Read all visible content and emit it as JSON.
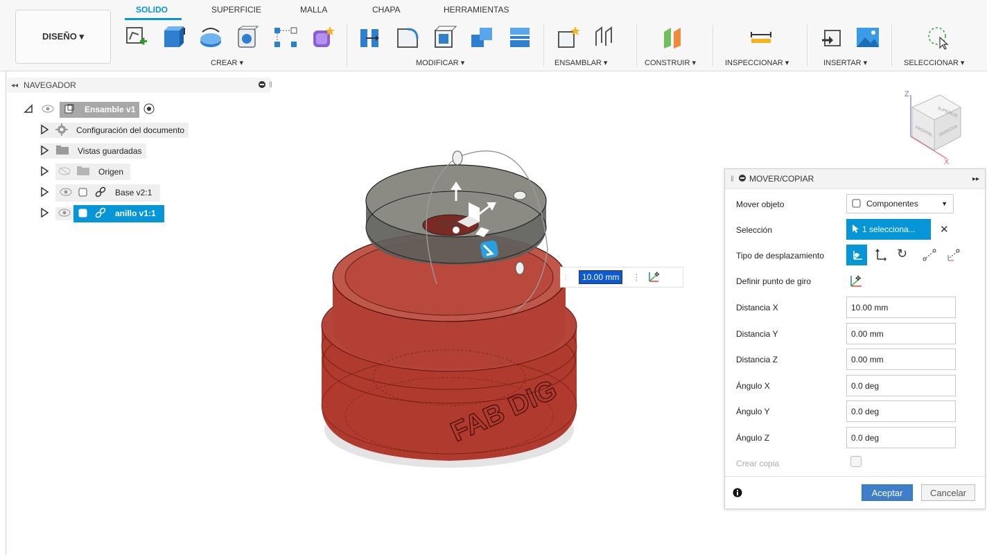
{
  "toolbar": {
    "workspace_label": "DISEÑO ▾",
    "tabs": [
      {
        "label": "SOLIDO"
      },
      {
        "label": "SUPERFICIE"
      },
      {
        "label": "MALLA"
      },
      {
        "label": "CHAPA"
      },
      {
        "label": "HERRAMIENTAS"
      }
    ],
    "groups": {
      "crear": "CREAR ▾",
      "modificar": "MODIFICAR ▾",
      "ensamblar": "ENSAMBLAR ▾",
      "construir": "CONSTRUIR ▾",
      "inspeccionar": "INSPECCIONAR ▾",
      "insertar": "INSERTAR ▾",
      "seleccionar": "SELECCIONAR ▾"
    },
    "accent": "#0696d7"
  },
  "navigator": {
    "title": "NAVEGADOR",
    "root": "Ensamble v1",
    "items": [
      {
        "label": "Configuración del documento"
      },
      {
        "label": "Vistas guardadas"
      },
      {
        "label": "Origen"
      },
      {
        "label": "Base v2:1"
      },
      {
        "label": "anillo v1:1"
      }
    ]
  },
  "viewport": {
    "distance_input": "10.00 mm",
    "ring_label": "10.00",
    "engraving": "FAB DIG",
    "viewcube": {
      "top": "SUPERIOR",
      "front": "FRONTAL",
      "right": "DERECHA"
    }
  },
  "dialog": {
    "title": "MOVER/COPIAR",
    "rows": {
      "move_object": {
        "label": "Mover objeto",
        "value": "Componentes"
      },
      "selection": {
        "label": "Selección",
        "value": "1 selecciona..."
      },
      "move_type": {
        "label": "Tipo de desplazamiento"
      },
      "pivot": {
        "label": "Definir punto de giro"
      },
      "dist_x": {
        "label": "Distancia X",
        "value": "10.00 mm"
      },
      "dist_y": {
        "label": "Distancia Y",
        "value": "0.00 mm"
      },
      "dist_z": {
        "label": "Distancia Z",
        "value": "0.00 mm"
      },
      "angle_x": {
        "label": "Ángulo X",
        "value": "0.0 deg"
      },
      "angle_y": {
        "label": "Ángulo Y",
        "value": "0.0 deg"
      },
      "angle_z": {
        "label": "Ángulo Z",
        "value": "0.0 deg"
      },
      "copy": {
        "label": "Crear copia"
      }
    },
    "ok": "Aceptar",
    "cancel": "Cancelar"
  }
}
